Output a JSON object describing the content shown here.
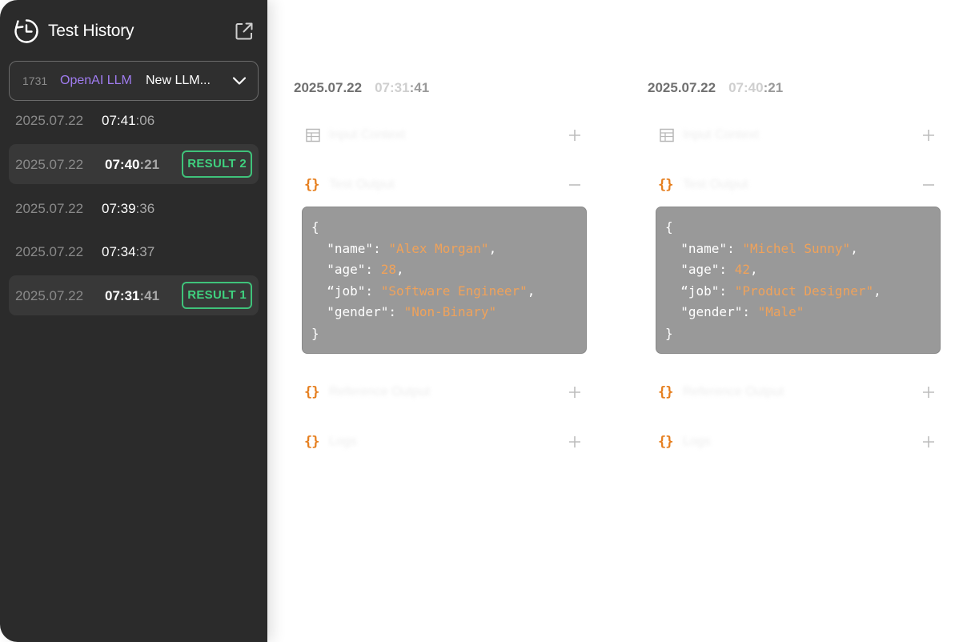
{
  "sidebar": {
    "title": "Test History",
    "selector": {
      "id": "1731",
      "provider": "OpenAI LLM",
      "name": "New LLM..."
    },
    "items": [
      {
        "date": "2025.07.22",
        "time_hm": "07:41",
        "time_s": ":06",
        "badge": "",
        "active": false
      },
      {
        "date": "2025.07.22",
        "time_hm": "07:40",
        "time_s": ":21",
        "badge": "RESULT 2",
        "active": true
      },
      {
        "date": "2025.07.22",
        "time_hm": "07:39",
        "time_s": ":36",
        "badge": "",
        "active": false
      },
      {
        "date": "2025.07.22",
        "time_hm": "07:34",
        "time_s": ":37",
        "badge": "",
        "active": false
      },
      {
        "date": "2025.07.22",
        "time_hm": "07:31",
        "time_s": ":41",
        "badge": "RESULT 1",
        "active": true
      }
    ]
  },
  "panels": [
    {
      "date": "2025.07.22",
      "time_hm": "07:31",
      "time_s": ":41",
      "json": {
        "name": "\"Alex Morgan\"",
        "age": "28",
        "job": "\"Software Engineer\"",
        "gender": "\"Non-Binary\""
      }
    },
    {
      "date": "2025.07.22",
      "time_hm": "07:40",
      "time_s": ":21",
      "json": {
        "name": "\"Michel Sunny\"",
        "age": "42",
        "job": "\"Product Designer\"",
        "gender": "\"Male\""
      }
    }
  ],
  "icons": {
    "accent_orange": "#e67f1f",
    "badge_green": "#3fc27a",
    "provider_purple": "#a07cf0"
  }
}
